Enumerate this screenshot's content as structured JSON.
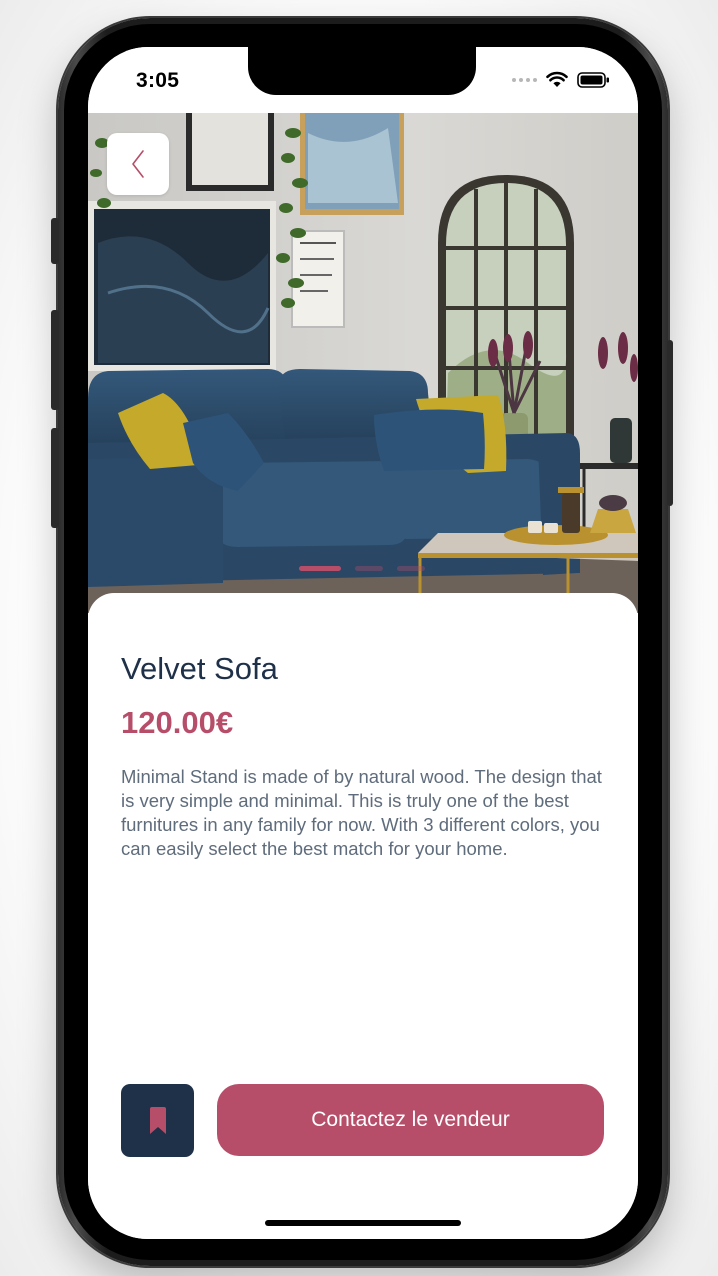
{
  "status_bar": {
    "time": "3:05"
  },
  "product": {
    "title": "Velvet Sofa",
    "price": "120.00€",
    "description": "Minimal Stand is made of by natural wood. The design that is very simple and minimal. This is truly one of the best furnitures in any family for now. With 3 different colors, you can easily select the best match for your home."
  },
  "image_carousel": {
    "page_count": 3,
    "active_page": 1
  },
  "actions": {
    "contact_label": "Contactez le vendeur"
  },
  "icons": {
    "back": "chevron-left-icon",
    "bookmark": "bookmark-icon",
    "wifi": "wifi-icon",
    "battery": "battery-icon"
  },
  "colors": {
    "brand_navy": "#1f3049",
    "brand_rose": "#b64e69",
    "description_text": "#5f6c7c",
    "sofa": "#2f4e6b",
    "pillow_mustard": "#c4a92a"
  }
}
